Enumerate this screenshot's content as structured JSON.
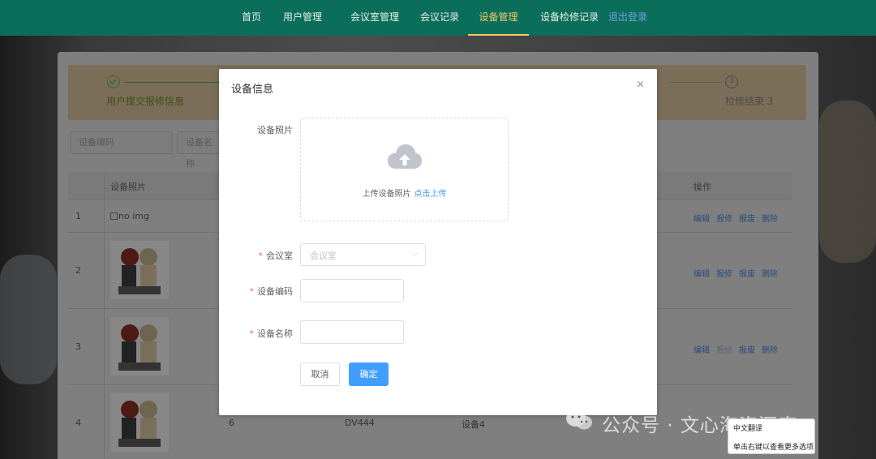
{
  "nav": {
    "items": [
      "首页",
      "用户管理",
      "会议室管理",
      "会议记录",
      "设备管理",
      "设备检修记录"
    ],
    "active": "设备管理",
    "extra": "退出登录"
  },
  "steps": {
    "step1": "用户提交报修信息",
    "step3": "检修结束 3",
    "step3_num": "3"
  },
  "filters": {
    "code_placeholder": "设备编码",
    "name_placeholder": "设备名称"
  },
  "table": {
    "col_photo": "设备照片",
    "col_ops": "操作",
    "rows": [
      {
        "idx": "1",
        "noimg": "no img",
        "ops": [
          "编辑",
          "报修",
          "报废",
          "删除"
        ]
      },
      {
        "idx": "2",
        "ops": [
          "编辑",
          "报修",
          "报废",
          "删除"
        ]
      },
      {
        "idx": "3",
        "ops": [
          "编辑",
          "报修",
          "报废",
          "删除"
        ]
      },
      {
        "idx": "4",
        "room": "6",
        "code": "DV444",
        "name": "设备4"
      }
    ]
  },
  "modal": {
    "title": "设备信息",
    "close": "×",
    "photo_label": "设备照片",
    "upload_text": "上传设备照片",
    "upload_link": "点击上传",
    "room_label": "会议室",
    "room_placeholder": "会议室",
    "code_label": "设备编码",
    "name_label": "设备名称",
    "required_mark": "*",
    "cancel": "取消",
    "ok": "确定"
  },
  "context_menu": {
    "line1": "中文翻译",
    "line2": "单击右键以查看更多选项"
  },
  "watermark": "公众号 · 文心海资源库",
  "colors": {
    "nav_bg": "#0b6e5a",
    "nav_active": "#f3c86a",
    "primary": "#409eff",
    "danger": "#f56c6c"
  }
}
